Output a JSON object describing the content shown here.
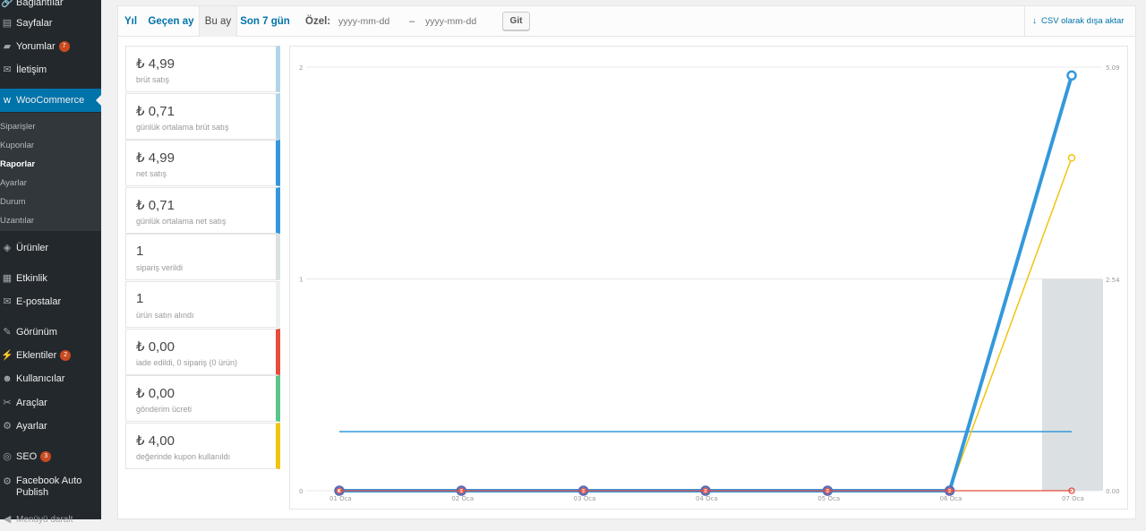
{
  "sidebar": {
    "items": [
      {
        "label": "Bağlantılar",
        "icon": "link-icon",
        "name": "sidebar-item-links",
        "glyph": "🔗"
      },
      {
        "label": "Sayfalar",
        "icon": "page-icon",
        "name": "sidebar-item-pages",
        "glyph": "▤"
      },
      {
        "label": "Yorumlar",
        "icon": "comment-icon",
        "name": "sidebar-item-comments",
        "glyph": "▰",
        "badge": "7"
      },
      {
        "label": "İletişim",
        "icon": "mail-icon",
        "name": "sidebar-item-contact",
        "glyph": "✉"
      },
      {
        "label": "WooCommerce",
        "icon": "woo-icon",
        "name": "sidebar-item-woocommerce",
        "glyph": "w"
      },
      {
        "label": "Ürünler",
        "icon": "box-icon",
        "name": "sidebar-item-products",
        "glyph": "◈"
      },
      {
        "label": "Etkinlik",
        "icon": "calendar-icon",
        "name": "sidebar-item-events",
        "glyph": "▦"
      },
      {
        "label": "E-postalar",
        "icon": "email-icon",
        "name": "sidebar-item-emails",
        "glyph": "✉"
      },
      {
        "label": "Görünüm",
        "icon": "brush-icon",
        "name": "sidebar-item-appearance",
        "glyph": "✎"
      },
      {
        "label": "Eklentiler",
        "icon": "plugin-icon",
        "name": "sidebar-item-plugins",
        "glyph": "⚡",
        "badge": "2"
      },
      {
        "label": "Kullanıcılar",
        "icon": "user-icon",
        "name": "sidebar-item-users",
        "glyph": "☻"
      },
      {
        "label": "Araçlar",
        "icon": "wrench-icon",
        "name": "sidebar-item-tools",
        "glyph": "✂"
      },
      {
        "label": "Ayarlar",
        "icon": "settings-icon",
        "name": "sidebar-item-settings",
        "glyph": "⚙"
      },
      {
        "label": "SEO",
        "icon": "seo-icon",
        "name": "sidebar-item-seo",
        "glyph": "◎",
        "badge": "3"
      },
      {
        "label": "Facebook Auto Publish",
        "icon": "gear-icon",
        "name": "sidebar-item-facebook",
        "glyph": "⚙"
      },
      {
        "label": "Menüyü daralt",
        "icon": "collapse-icon",
        "name": "sidebar-item-collapse",
        "glyph": "◀"
      }
    ],
    "submenu": [
      "Siparişler",
      "Kuponlar",
      "Raporlar",
      "Ayarlar",
      "Durum",
      "Uzantılar"
    ],
    "current_sub": "Raporlar"
  },
  "range_tabs": [
    "Yıl",
    "Geçen ay",
    "Bu ay",
    "Son 7 gün"
  ],
  "active_tab": "Bu ay",
  "custom": {
    "label": "Özel:",
    "from_placeholder": "yyyy-mm-dd",
    "dash": "–",
    "to_placeholder": "yyyy-mm-dd",
    "go_label": "Git"
  },
  "export_label": "CSV olarak dışa aktar",
  "legend": [
    {
      "amount": "₺ 4,99",
      "desc": "brüt satış",
      "color": "#b1d4ea"
    },
    {
      "amount": "₺ 0,71",
      "desc": "günlük ortalama brüt satış",
      "color": "#b1d4ea"
    },
    {
      "amount": "₺ 4,99",
      "desc": "net satış",
      "color": "#3498db"
    },
    {
      "amount": "₺ 0,71",
      "desc": "günlük ortalama net satış",
      "color": "#3498db"
    },
    {
      "amount": "1",
      "desc": "sipariş verildi",
      "color": "#dbe1e3"
    },
    {
      "amount": "1",
      "desc": "ürün satın alındı",
      "color": "#ecf0f1"
    },
    {
      "amount": "₺ 0,00",
      "desc": "iade edildi, 0 sipariş (0 ürün)",
      "color": "#e74c3c"
    },
    {
      "amount": "₺ 0,00",
      "desc": "gönderim ücreti",
      "color": "#5cc488"
    },
    {
      "amount": "₺ 4,00",
      "desc": "değerinde kupon kullanıldı",
      "color": "#f1c40f"
    }
  ],
  "chart_data": {
    "type": "line",
    "x": [
      "01 Oca",
      "02 Oca",
      "03 Oca",
      "04 Oca",
      "05 Oca",
      "06 Oca",
      "07 Oca"
    ],
    "y_left_ticks": [
      "0",
      "1",
      "2"
    ],
    "y_right_ticks": [
      "0.00",
      "2.54",
      "5.09"
    ],
    "y_left_range": [
      0,
      2
    ],
    "y_right_range": [
      0,
      5.09
    ],
    "grid": true,
    "series": [
      {
        "key": "orders",
        "type": "bar",
        "axis": "left",
        "values": [
          0,
          0,
          0,
          0,
          0,
          0,
          1
        ],
        "color": "#dbe1e3"
      },
      {
        "key": "net_sales",
        "type": "line",
        "axis": "right",
        "values": [
          0,
          0,
          0,
          0,
          0,
          0,
          4.99
        ],
        "color": "#3498db"
      },
      {
        "key": "avg_net",
        "type": "line",
        "axis": "right",
        "values": [
          0.71,
          0.71,
          0.71,
          0.71,
          0.71,
          0.71,
          0.71
        ],
        "color": "#3498db"
      },
      {
        "key": "coupons",
        "type": "line",
        "axis": "right",
        "values": [
          0,
          0,
          0,
          0,
          0,
          0,
          4.0
        ],
        "color": "#f1c40f"
      },
      {
        "key": "refunds",
        "type": "line",
        "axis": "right",
        "values": [
          0,
          0,
          0,
          0,
          0,
          0,
          0
        ],
        "color": "#e74c3c"
      }
    ]
  }
}
